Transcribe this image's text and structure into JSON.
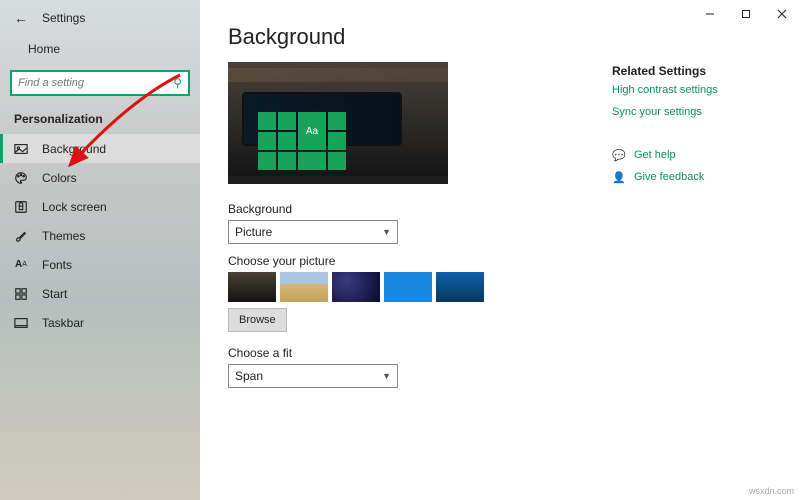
{
  "app": {
    "title": "Settings"
  },
  "window_controls": {
    "min": "minimize",
    "max": "maximize",
    "close": "close"
  },
  "sidebar": {
    "home": "Home",
    "search_placeholder": "Find a setting",
    "category": "Personalization",
    "items": [
      {
        "icon": "picture-icon",
        "label": "Background",
        "selected": true
      },
      {
        "icon": "palette-icon",
        "label": "Colors",
        "selected": false
      },
      {
        "icon": "lock-icon",
        "label": "Lock screen",
        "selected": false
      },
      {
        "icon": "brush-icon",
        "label": "Themes",
        "selected": false
      },
      {
        "icon": "font-icon",
        "label": "Fonts",
        "selected": false
      },
      {
        "icon": "start-icon",
        "label": "Start",
        "selected": false
      },
      {
        "icon": "taskbar-icon",
        "label": "Taskbar",
        "selected": false
      }
    ]
  },
  "main": {
    "title": "Background",
    "preview_tile_text": "Aa",
    "bg_dropdown": {
      "label": "Background",
      "value": "Picture"
    },
    "choose_picture_label": "Choose your picture",
    "browse_label": "Browse",
    "fit_dropdown": {
      "label": "Choose a fit",
      "value": "Span"
    }
  },
  "related": {
    "heading": "Related Settings",
    "links": [
      "High contrast settings",
      "Sync your settings"
    ],
    "help": [
      {
        "icon": "chat-icon",
        "label": "Get help"
      },
      {
        "icon": "person-icon",
        "label": "Give feedback"
      }
    ]
  },
  "watermark": "wsxdn.com"
}
